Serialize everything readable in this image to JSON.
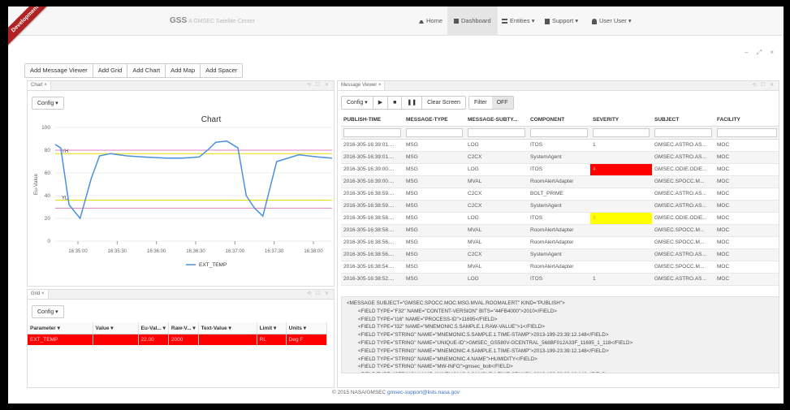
{
  "app": {
    "ribbon": "Development",
    "brand": "GSS",
    "brand_sub": "A GMSEC Satellite Center"
  },
  "nav": [
    {
      "label": "Home",
      "icon": "home-icon"
    },
    {
      "label": "Dashboard",
      "icon": "dashboard-icon"
    },
    {
      "label": "Entities",
      "icon": "list-icon"
    },
    {
      "label": "Support",
      "icon": "book-icon"
    },
    {
      "label": "User User",
      "icon": "user-icon"
    }
  ],
  "window_controls": "– ⤢ ×",
  "toolbar": [
    "Add Message Viewer",
    "Add Grid",
    "Add Chart",
    "Add Map",
    "Add Spacer"
  ],
  "chart_panel": {
    "tab": "Chart",
    "config": "Config ▾"
  },
  "grid_panel": {
    "tab": "Grid",
    "config": "Config ▾",
    "columns": [
      "Parameter",
      "Value",
      "Eu-Val...",
      "Raw-V...",
      "Text-Value",
      "Limit",
      "Units"
    ],
    "row": [
      "EXT_TEMP",
      "",
      "22.00",
      "2000",
      "",
      "RL",
      "Deg F"
    ]
  },
  "message_panel": {
    "tab": "Message Viewer",
    "config": "Config ▾",
    "clear": "Clear Screen",
    "filter": "Filter",
    "off": "OFF",
    "columns": [
      "PUBLISH-TIME",
      "MESSAGE-TYPE",
      "MESSAGE-SUBTY...",
      "COMPONENT",
      "SEVERITY",
      "SUBJECT",
      "FACILITY"
    ],
    "rows": [
      [
        "2016-305-16:39:01....",
        "MSG",
        "LOG",
        "ITOS",
        "1",
        "GMSEC.ASTRO.AS...",
        "MOC"
      ],
      [
        "2016-305-16:39:01....",
        "MSG",
        "C2CX",
        "SystemAgent",
        "",
        "GMSEC.ASTRO.AS...",
        "MOC"
      ],
      [
        "2016-305-16:39:00....",
        "MSG",
        "LOG",
        "ITOS",
        "4",
        "GMSEC.ODIE.ODIE...",
        "MOC"
      ],
      [
        "2016-305-16:39:00....",
        "MSG",
        "MVAL",
        "RoomAlertAdapter",
        "",
        "GMSEC.SPOCC.M...",
        "MOC"
      ],
      [
        "2016-305-16:38:59....",
        "MSG",
        "C2CX",
        "BOLT_PRIME",
        "",
        "GMSEC.ASTRO.AS...",
        "MOC"
      ],
      [
        "2016-305-16:38:59....",
        "MSG",
        "C2CX",
        "SystemAgent",
        "",
        "GMSEC.ASTRO.AS...",
        "MOC"
      ],
      [
        "2016-305-16:38:58....",
        "MSG",
        "LOG",
        "ITOS",
        "3",
        "GMSEC.ODIE.ODIE...",
        "MOC"
      ],
      [
        "2016-305-16:38:58....",
        "MSG",
        "MVAL",
        "RoomAlertAdapter",
        "",
        "GMSEC.SPOCC.M...",
        "MOC"
      ],
      [
        "2016-305-16:38:56....",
        "MSG",
        "MVAL",
        "RoomAlertAdapter",
        "",
        "GMSEC.SPOCC.M...",
        "MOC"
      ],
      [
        "2016-305-16:38:56....",
        "MSG",
        "C2CX",
        "SystemAgent",
        "",
        "GMSEC.ASTRO.AS...",
        "MOC"
      ],
      [
        "2016-305-16:38:54....",
        "MSG",
        "MVAL",
        "RoomAlertAdapter",
        "",
        "GMSEC.SPOCC.M...",
        "MOC"
      ],
      [
        "2016-305-16:38:52....",
        "MSG",
        "LOG",
        "ITOS",
        "1",
        "GMSEC.ASTRO.AS...",
        "MOC"
      ]
    ],
    "severity_colors": {
      "4": "#ff0000",
      "3": "#ffff00"
    }
  },
  "xml": [
    "<MESSAGE SUBJECT=\"GMSEC.SPOCC.MOC.MSG.MVAL.ROOMALERT\" KIND=\"PUBLISH\">",
    "<FIELD TYPE=\"F32\" NAME=\"CONTENT-VERSION\" BITS=\"44FB4000\">2010</FIELD>",
    "<FIELD TYPE=\"I16\" NAME=\"PROCESS-ID\">11695</FIELD>",
    "<FIELD TYPE=\"I32\" NAME=\"MNEMONIC.5.SAMPLE.1.RAW-VALUE\">1</FIELD>",
    "<FIELD TYPE=\"STRING\" NAME=\"MNEMONIC.5.SAMPLE.1.TIME-STAMP\">2013-199-23:39:12.148</FIELD>",
    "<FIELD TYPE=\"STRING\" NAME=\"UNIQUE-ID\">GMSEC_GS580V-GCENTRAL_568BF012A33F_11695_1_118</FIELD>",
    "<FIELD TYPE=\"STRING\" NAME=\"MNEMONIC.4.SAMPLE.1.TIME-STAMP\">2013-199-23:39:12.148</FIELD>",
    "<FIELD TYPE=\"STRING\" NAME=\"MNEMONIC.4.NAME\">HUMIDITY</FIELD>",
    "<FIELD TYPE=\"STRING\" NAME=\"MW-INFO\">gmsec_bolt</FIELD>",
    "<FIELD TYPE=\"STRING\" NAME=\"MNEMONIC.6.SAMPLE.1.TIME-STAMP\">2013-199-23:39:12.148</FIELD>"
  ],
  "footer": {
    "text": "© 2015 NASA/GMSEC",
    "email": "gmsec-support@lists.nasa.gov"
  },
  "chart_data": {
    "type": "line",
    "title": "Chart",
    "xlabel": "",
    "ylabel": "Eu-Value",
    "ylim": [
      0,
      100
    ],
    "yticks": [
      0,
      20,
      40,
      60,
      80,
      100
    ],
    "xticks": [
      "16:35:00",
      "16:35:30",
      "16:36:00",
      "16:36:30",
      "16:37:00",
      "16:37:30",
      "16:38:00"
    ],
    "limit_lines": [
      {
        "label": "YH",
        "value": 77,
        "color": "#e8d800"
      },
      {
        "label": "",
        "value": 80,
        "color": "#e080c0"
      },
      {
        "label": "YL",
        "value": 36,
        "color": "#e8d800"
      },
      {
        "label": "",
        "value": 29,
        "color": "#e080c0"
      }
    ],
    "series": [
      {
        "name": "EXT_TEMP",
        "color": "#4a8fe0",
        "x": [
          0,
          0.02,
          0.05,
          0.09,
          0.13,
          0.16,
          0.2,
          0.26,
          0.32,
          0.4,
          0.46,
          0.52,
          0.55,
          0.58,
          0.62,
          0.66,
          0.69,
          0.72,
          0.75,
          0.8,
          0.88,
          0.95,
          1.0
        ],
        "values": [
          85,
          82,
          32,
          20,
          55,
          75,
          77,
          75,
          74,
          73,
          73,
          74,
          80,
          87,
          88,
          82,
          40,
          29,
          22,
          70,
          76,
          74,
          73
        ]
      }
    ],
    "x_range_label": "16:34:50 to 16:38:10",
    "legend_position": "bottom"
  }
}
